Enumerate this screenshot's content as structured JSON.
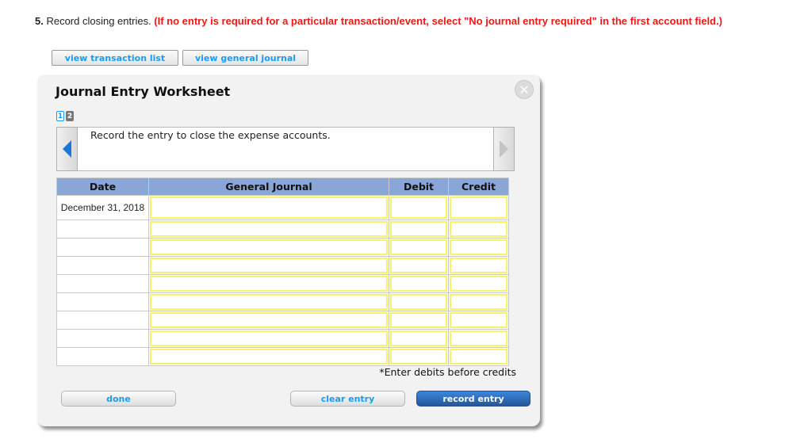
{
  "instruction": {
    "number": "5.",
    "text": " Record closing entries. ",
    "warning": "(If no entry is required for a particular transaction/event, select \"No journal entry required\" in the first account field.)"
  },
  "top_buttons": {
    "transaction_list": "view transaction list",
    "general_journal": "view general journal"
  },
  "worksheet": {
    "title": "Journal Entry Worksheet",
    "close_glyph": "✕",
    "pages": [
      "1",
      "2"
    ],
    "active_page": 1,
    "prompt": "Record the entry to close the expense accounts.",
    "columns": [
      "Date",
      "General Journal",
      "Debit",
      "Credit"
    ],
    "rows": [
      {
        "date": "December 31, 2018",
        "account": "",
        "debit": "",
        "credit": ""
      },
      {
        "date": "",
        "account": "",
        "debit": "",
        "credit": ""
      },
      {
        "date": "",
        "account": "",
        "debit": "",
        "credit": ""
      },
      {
        "date": "",
        "account": "",
        "debit": "",
        "credit": ""
      },
      {
        "date": "",
        "account": "",
        "debit": "",
        "credit": ""
      },
      {
        "date": "",
        "account": "",
        "debit": "",
        "credit": ""
      },
      {
        "date": "",
        "account": "",
        "debit": "",
        "credit": ""
      },
      {
        "date": "",
        "account": "",
        "debit": "",
        "credit": ""
      },
      {
        "date": "",
        "account": "",
        "debit": "",
        "credit": ""
      }
    ],
    "hint": "*Enter debits before credits",
    "buttons": {
      "done": "done",
      "clear": "clear entry",
      "record": "record entry"
    }
  },
  "colors": {
    "warning": "#f21717",
    "link_blue": "#1a9cf0",
    "header_blue": "#8aa6d6",
    "input_border": "#f6f36a",
    "primary_button": "#24569c"
  }
}
